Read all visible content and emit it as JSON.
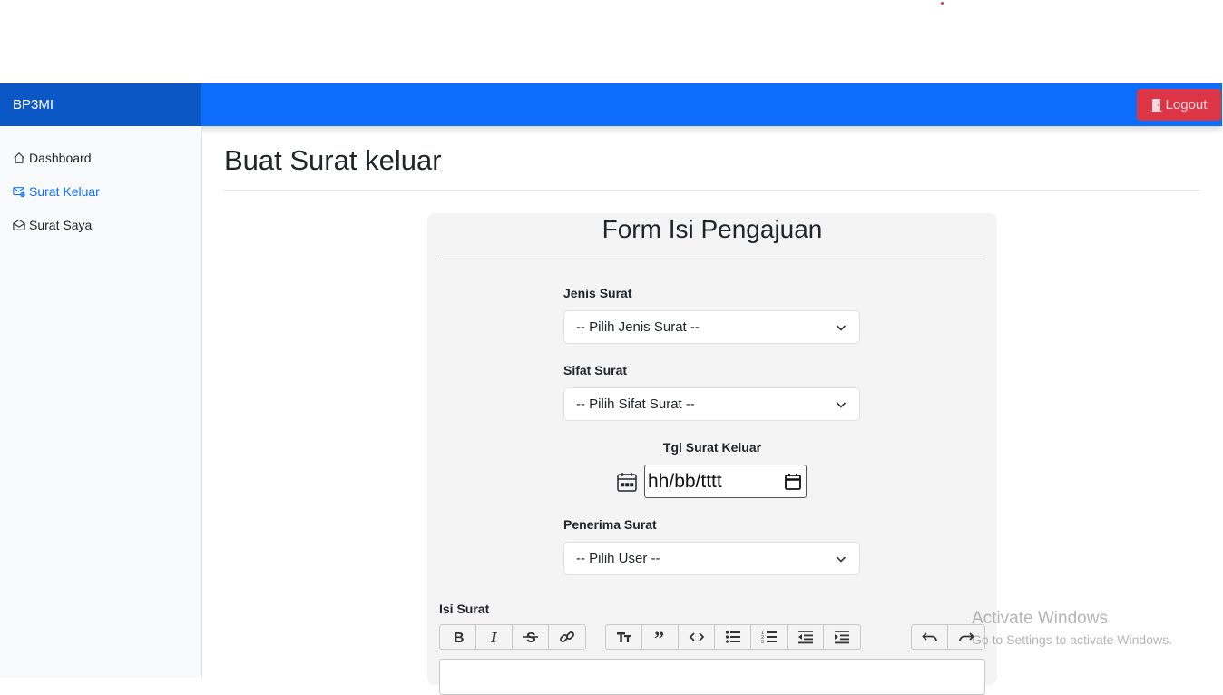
{
  "app": {
    "brand": "BP3MI",
    "logout_label": "Logout"
  },
  "sidebar": {
    "items": [
      {
        "label": "Dashboard",
        "icon": "house-icon",
        "active": false
      },
      {
        "label": "Surat Keluar",
        "icon": "envelope-gear-icon",
        "active": true
      },
      {
        "label": "Surat Saya",
        "icon": "envelope-open-icon",
        "active": false
      }
    ]
  },
  "page": {
    "title": "Buat Surat keluar"
  },
  "form": {
    "title": "Form Isi Pengajuan",
    "jenis": {
      "label": "Jenis Surat",
      "selected": "-- Pilih Jenis Surat --"
    },
    "sifat": {
      "label": "Sifat Surat",
      "selected": "-- Pilih Sifat Surat --"
    },
    "tgl": {
      "label": "Tgl Surat Keluar",
      "placeholder": "hh/bb/tttt"
    },
    "penerima": {
      "label": "Penerima Surat",
      "selected": "-- Pilih User --"
    },
    "isi": {
      "label": "Isi Surat"
    }
  },
  "editor_toolbar": {
    "format": [
      "bold-icon",
      "italic-icon",
      "strikethrough-icon",
      "link-icon"
    ],
    "block": [
      "heading-icon",
      "quote-icon",
      "code-icon",
      "bullet-list-icon",
      "numbered-list-icon",
      "outdent-icon",
      "indent-icon"
    ],
    "history": [
      "undo-icon",
      "redo-icon"
    ]
  },
  "watermark": {
    "line1": "Activate Windows",
    "line2": "Go to Settings to activate Windows."
  },
  "colors": {
    "primary": "#0d6efd",
    "brand_bg": "#0b57c5",
    "danger": "#dc3545",
    "card_bg": "#f4f4f4"
  }
}
